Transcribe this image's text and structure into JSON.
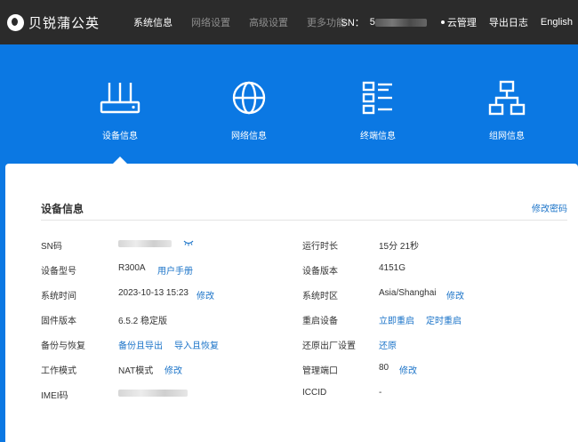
{
  "header": {
    "brand": "贝锐蒲公英",
    "nav": [
      "系统信息",
      "网络设置",
      "高级设置",
      "更多功能"
    ],
    "sn_label": "SN：",
    "sn_value": "5",
    "cloud": "云管理",
    "export_log": "导出日志",
    "language": "English"
  },
  "tabs": [
    {
      "label": "设备信息",
      "icon": "router-icon",
      "active": true
    },
    {
      "label": "网络信息",
      "icon": "globe-icon"
    },
    {
      "label": "终端信息",
      "icon": "list-icon"
    },
    {
      "label": "组网信息",
      "icon": "network-topology-icon"
    }
  ],
  "panel": {
    "title": "设备信息",
    "change_password": "修改密码"
  },
  "left": {
    "sn_label": "SN码",
    "model_label": "设备型号",
    "model_value": "R300A",
    "model_link": "用户手册",
    "time_label": "系统时间",
    "time_value": "2023-10-13 15:23",
    "time_link": "修改",
    "fw_label": "固件版本",
    "fw_value": "6.5.2 稳定版",
    "backup_label": "备份与恢复",
    "backup_link": "备份且导出",
    "import_link": "导入且恢复",
    "mode_label": "工作模式",
    "mode_value": "NAT模式",
    "mode_link": "修改",
    "imei_label": "IMEI码"
  },
  "right": {
    "uptime_label": "运行时长",
    "uptime_value": "15分 21秒",
    "version_label": "设备版本",
    "version_value": "4151G",
    "tz_label": "系统时区",
    "tz_value": "Asia/Shanghai",
    "tz_link": "修改",
    "reboot_label": "重启设备",
    "reboot_now": "立即重启",
    "reboot_timer": "定时重启",
    "factory_label": "还原出厂设置",
    "factory_link": "还原",
    "port_label": "管理端口",
    "port_value": "80",
    "port_link": "修改",
    "iccid_label": "ICCID",
    "iccid_value": "-"
  },
  "colors": {
    "topbar": "#2b2b2b",
    "banner": "#0b78e3",
    "link": "#1a73c8"
  }
}
